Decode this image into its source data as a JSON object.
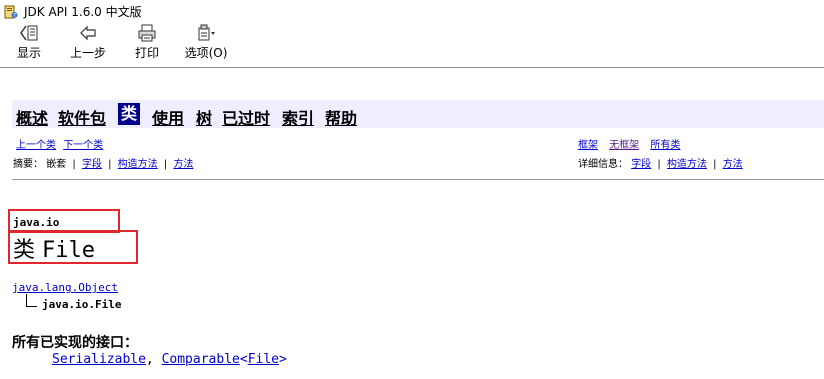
{
  "window": {
    "title": "JDK API 1.6.0 中文版",
    "icon": "help-book-icon"
  },
  "toolbar": {
    "show": "显示",
    "back": "上一步",
    "print": "打印",
    "options": "选项(O)"
  },
  "navbar": {
    "overview": "概述",
    "package": "软件包",
    "class": "类",
    "use": "使用",
    "tree": "树",
    "deprecated": "已过时",
    "index": "索引",
    "help": "帮助"
  },
  "subnav_left": {
    "prev_class": "上一个类",
    "next_class": "下一个类",
    "summary_label": "摘要：",
    "nested": "嵌套",
    "field": "字段",
    "constructor": "构造方法",
    "method": "方法",
    "sep": "|"
  },
  "subnav_right": {
    "frames": "框架",
    "no_frames": "无框架",
    "all_classes": "所有类",
    "detail_label": "详细信息：",
    "field": "字段",
    "constructor": "构造方法",
    "method": "方法",
    "sep": "|"
  },
  "class_header": {
    "package": "java.io",
    "class_word": "类",
    "class_name": "File"
  },
  "inheritance": {
    "parent": "java.lang.Object",
    "self": "java.io.File"
  },
  "interfaces": {
    "heading": "所有已实现的接口：",
    "serializable": "Serializable",
    "comma": ", ",
    "comparable": "Comparable",
    "lt": "<",
    "file": "File",
    "gt": ">"
  },
  "colors": {
    "highlight_box": "#e0282c",
    "navbar_bg": "#eeeeff",
    "active_tab": "#00008b",
    "link": "#0000cc"
  }
}
